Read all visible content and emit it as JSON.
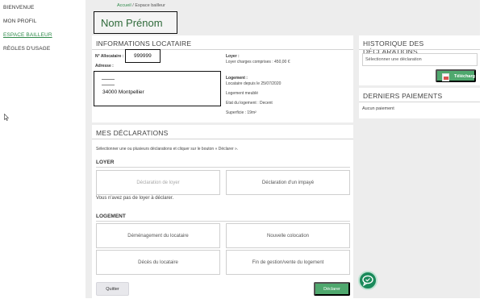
{
  "nav": {
    "items": [
      {
        "label": "BIENVENUE",
        "active": false
      },
      {
        "label": "MON PROFIL",
        "active": false
      },
      {
        "label": "ESPACE BAILLEUR",
        "active": true
      },
      {
        "label": "RÈGLES D'USAGE",
        "active": false
      }
    ]
  },
  "breadcrumb": {
    "home": "Accueil",
    "separator": " / ",
    "current": "Espace bailleur"
  },
  "user": {
    "name": "Nom Prénom"
  },
  "info": {
    "title": "INFORMATIONS LOCATAIRE",
    "alloc_label": "N° Allocataire :",
    "alloc_value": "999999",
    "address_label": "Adresse :",
    "address_city": "34000 Montpellier",
    "loyer_label": "Loyer :",
    "loyer_value": "Loyer charges comprises : 450,00 €",
    "logement_label": "Logement :",
    "logement_lines": [
      "Locataire depuis le 25/07/2020",
      "Logement meublé",
      "Etat du logement : Decent",
      "Superficie : 19m²"
    ]
  },
  "declarations": {
    "title": "MES DÉCLARATIONS",
    "intro": "Sélectionner une ou plusieurs déclarations et cliquer sur le bouton « Déclarer ».",
    "loyer_section": "LOYER",
    "loyer_tiles": [
      "Déclaration de loyer",
      "Déclaration d'un impayé"
    ],
    "loyer_note": "Vous n'avez pas de loyer à déclarer.",
    "logement_section": "LOGEMENT",
    "logement_tiles": [
      "Déménagement du locataire",
      "Nouvelle colocation",
      "Décès du locataire",
      "Fin de gestion/vente du logement"
    ],
    "quit_label": "Quitter",
    "declare_label": "Déclarer"
  },
  "historique": {
    "title": "HISTORIQUE DES DÉCLARATIONS",
    "select_placeholder": "Sélectionner une déclaration",
    "download_label": "Télécharg"
  },
  "paiements": {
    "title": "DERNIERS PAIEMENTS",
    "empty": "Aucun paiement"
  },
  "colors": {
    "accent": "#2f8a4a",
    "button_green": "#4fa86e",
    "chat": "#1a8a5a"
  },
  "icons": {
    "chat": "chat-bubble-icon",
    "excel": "excel-file-icon",
    "cursor": "mouse-pointer-icon"
  }
}
